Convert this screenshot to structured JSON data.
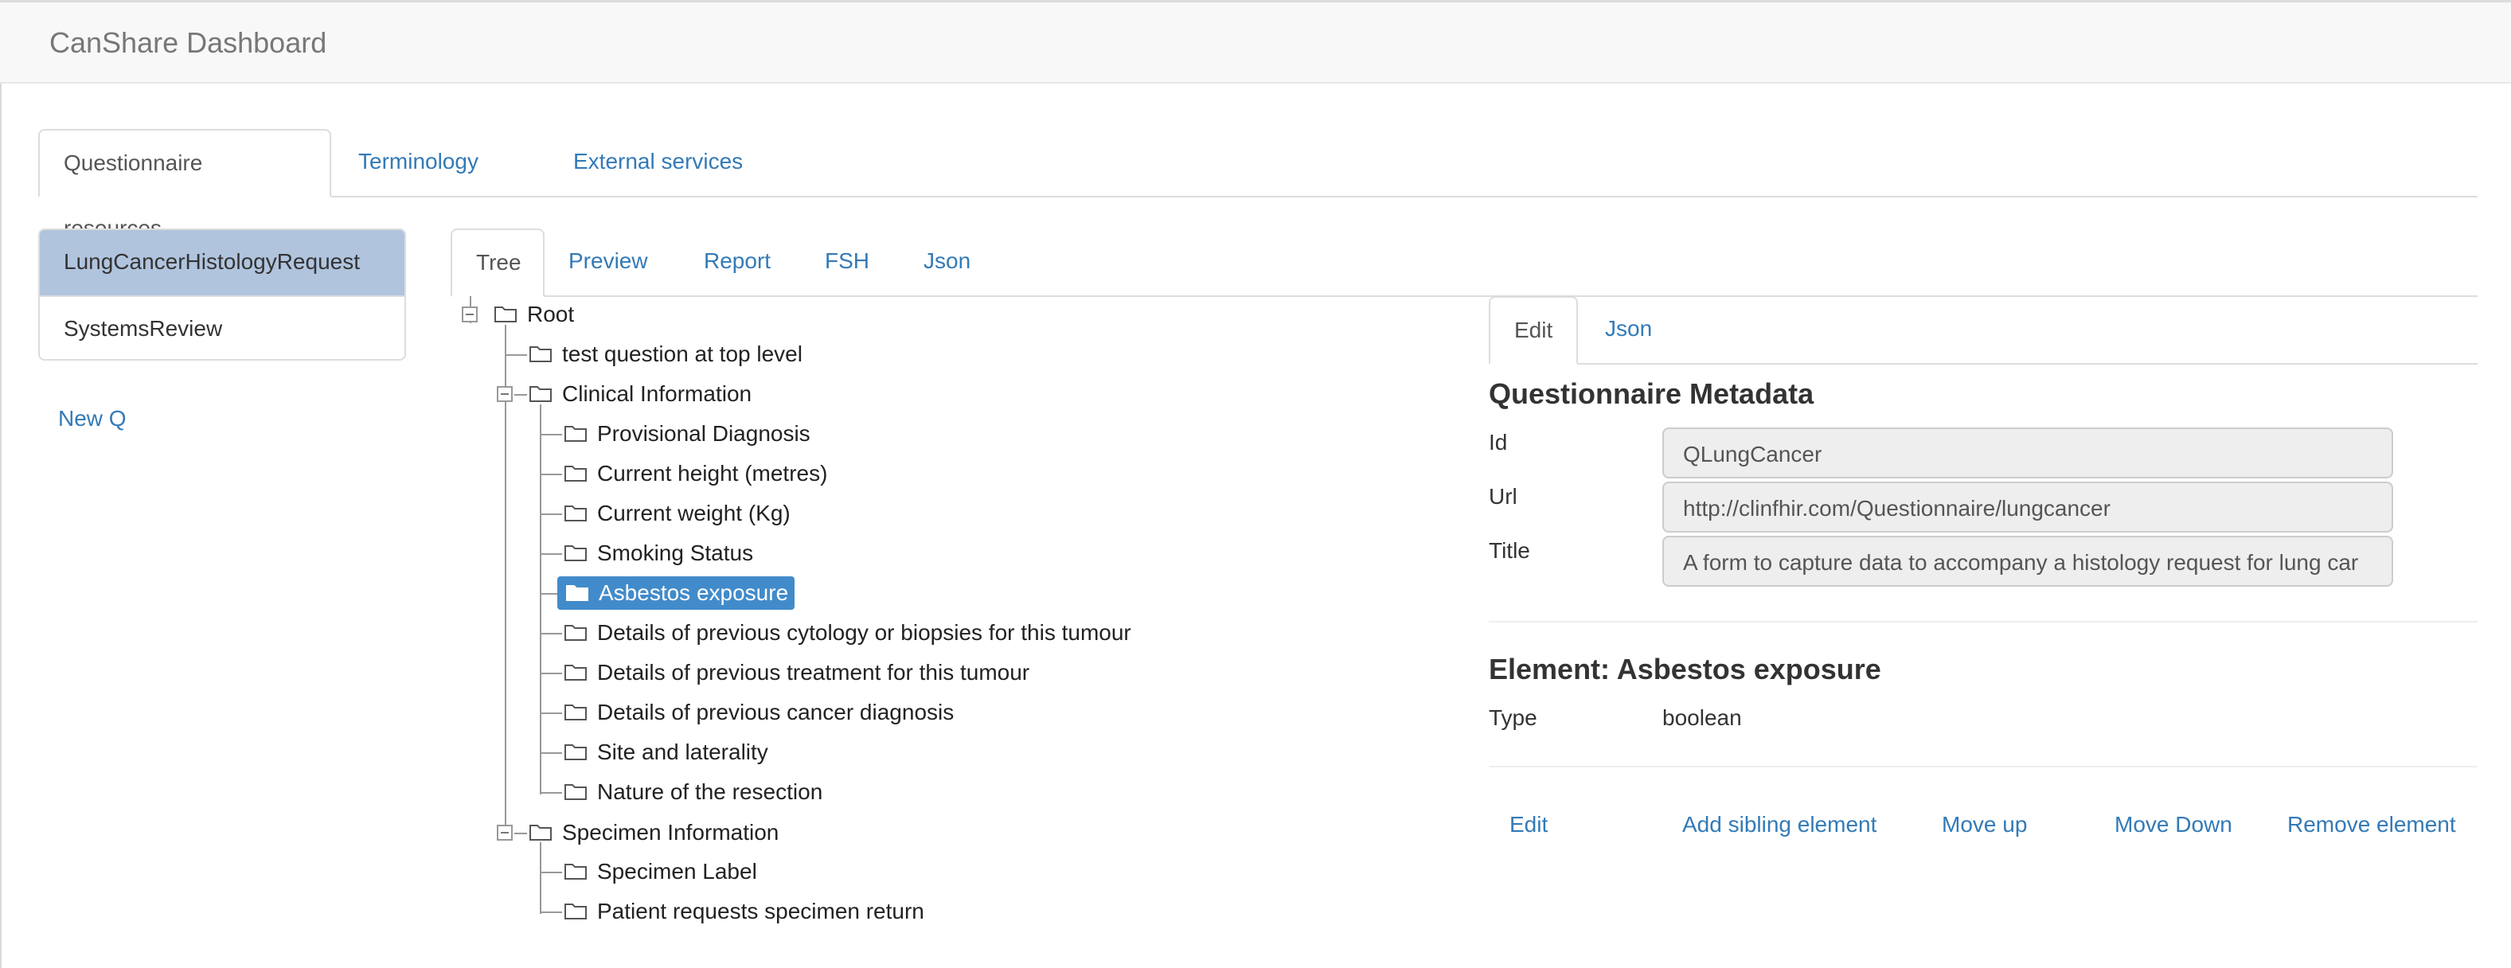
{
  "app": {
    "title": "CanShare Dashboard"
  },
  "main_tabs": [
    "Questionnaire resources",
    "Terminology",
    "External services"
  ],
  "questionnaires": {
    "items": [
      "LungCancerHistologyRequest",
      "SystemsReview"
    ],
    "new_label": "New Q"
  },
  "view_tabs": [
    "Tree",
    "Preview",
    "Report",
    "FSH",
    "Json"
  ],
  "tree": {
    "root": "Root",
    "top_item": "test question at top level",
    "clinical": {
      "label": "Clinical Information",
      "children": [
        "Provisional Diagnosis",
        "Current height (metres)",
        "Current weight (Kg)",
        "Smoking Status",
        "Asbestos exposure",
        "Details of previous cytology or biopsies for this tumour",
        "Details of previous treatment for this tumour",
        "Details of previous cancer diagnosis",
        "Site and laterality",
        "Nature of the resection"
      ]
    },
    "specimen": {
      "label": "Specimen Information",
      "children": [
        "Specimen Label",
        "Patient requests specimen return"
      ]
    }
  },
  "detail_tabs": [
    "Edit",
    "Json"
  ],
  "metadata": {
    "heading": "Questionnaire Metadata",
    "id_label": "Id",
    "id_value": "QLungCancer",
    "url_label": "Url",
    "url_value": "http://clinfhir.com/Questionnaire/lungcancer",
    "title_label": "Title",
    "title_value": "A form to capture data to accompany a histology request for lung car"
  },
  "element": {
    "heading": "Element: Asbestos exposure",
    "type_label": "Type",
    "type_value": "boolean"
  },
  "actions": [
    "Edit",
    "Add sibling element",
    "Move up",
    "Move Down",
    "Remove element"
  ]
}
